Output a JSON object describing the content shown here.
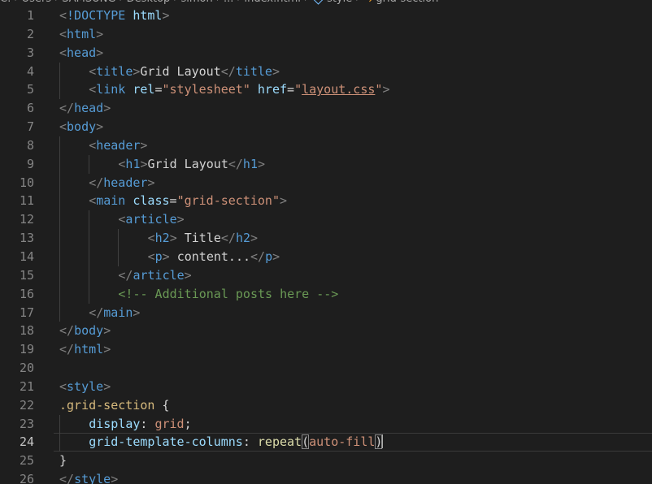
{
  "breadcrumb": {
    "items": [
      "C:",
      "Users",
      "SAMSUNG",
      "Desktop",
      "simon",
      "...",
      "index.html",
      "style",
      "grid-section"
    ],
    "icons": [
      "chevron-right-icon",
      "symbol-namespace-icon",
      "selector-icon"
    ]
  },
  "editor": {
    "current_line": 24,
    "lines": [
      {
        "n": "1",
        "indent": 0,
        "tokens": [
          [
            "punct",
            "<"
          ],
          [
            "tag",
            "!DOCTYPE"
          ],
          [
            "text",
            " "
          ],
          [
            "attr",
            "html"
          ],
          [
            "punct",
            ">"
          ]
        ]
      },
      {
        "n": "2",
        "indent": 0,
        "tokens": [
          [
            "punct",
            "<"
          ],
          [
            "tag",
            "html"
          ],
          [
            "punct",
            ">"
          ]
        ]
      },
      {
        "n": "3",
        "indent": 0,
        "tokens": [
          [
            "punct",
            "<"
          ],
          [
            "tag",
            "head"
          ],
          [
            "punct",
            ">"
          ]
        ]
      },
      {
        "n": "4",
        "indent": 1,
        "tokens": [
          [
            "punct",
            "<"
          ],
          [
            "tag",
            "title"
          ],
          [
            "punct",
            ">"
          ],
          [
            "text",
            "Grid Layout"
          ],
          [
            "punct",
            "</"
          ],
          [
            "tag",
            "title"
          ],
          [
            "punct",
            ">"
          ]
        ]
      },
      {
        "n": "5",
        "indent": 1,
        "tokens": [
          [
            "punct",
            "<"
          ],
          [
            "tag",
            "link"
          ],
          [
            "text",
            " "
          ],
          [
            "attr",
            "rel"
          ],
          [
            "text",
            "="
          ],
          [
            "str",
            "\"stylesheet\""
          ],
          [
            "text",
            " "
          ],
          [
            "attr",
            "href"
          ],
          [
            "text",
            "="
          ],
          [
            "str",
            "\""
          ],
          [
            "strlink",
            "layout.css"
          ],
          [
            "str",
            "\""
          ],
          [
            "punct",
            ">"
          ]
        ]
      },
      {
        "n": "6",
        "indent": 0,
        "tokens": [
          [
            "punct",
            "</"
          ],
          [
            "tag",
            "head"
          ],
          [
            "punct",
            ">"
          ]
        ]
      },
      {
        "n": "7",
        "indent": 0,
        "tokens": [
          [
            "punct",
            "<"
          ],
          [
            "tag",
            "body"
          ],
          [
            "punct",
            ">"
          ]
        ]
      },
      {
        "n": "8",
        "indent": 1,
        "tokens": [
          [
            "punct",
            "<"
          ],
          [
            "tag",
            "header"
          ],
          [
            "punct",
            ">"
          ]
        ]
      },
      {
        "n": "9",
        "indent": 2,
        "tokens": [
          [
            "punct",
            "<"
          ],
          [
            "tag",
            "h1"
          ],
          [
            "punct",
            ">"
          ],
          [
            "text",
            "Grid Layout"
          ],
          [
            "punct",
            "</"
          ],
          [
            "tag",
            "h1"
          ],
          [
            "punct",
            ">"
          ]
        ]
      },
      {
        "n": "10",
        "indent": 1,
        "tokens": [
          [
            "punct",
            "</"
          ],
          [
            "tag",
            "header"
          ],
          [
            "punct",
            ">"
          ]
        ]
      },
      {
        "n": "11",
        "indent": 1,
        "tokens": [
          [
            "punct",
            "<"
          ],
          [
            "tag",
            "main"
          ],
          [
            "text",
            " "
          ],
          [
            "attr",
            "class"
          ],
          [
            "text",
            "="
          ],
          [
            "str",
            "\"grid-section\""
          ],
          [
            "punct",
            ">"
          ]
        ]
      },
      {
        "n": "12",
        "indent": 2,
        "tokens": [
          [
            "punct",
            "<"
          ],
          [
            "tag",
            "article"
          ],
          [
            "punct",
            ">"
          ]
        ]
      },
      {
        "n": "13",
        "indent": 3,
        "tokens": [
          [
            "punct",
            "<"
          ],
          [
            "tag",
            "h2"
          ],
          [
            "punct",
            ">"
          ],
          [
            "text",
            " Title"
          ],
          [
            "punct",
            "</"
          ],
          [
            "tag",
            "h2"
          ],
          [
            "punct",
            ">"
          ]
        ]
      },
      {
        "n": "14",
        "indent": 3,
        "tokens": [
          [
            "punct",
            "<"
          ],
          [
            "tag",
            "p"
          ],
          [
            "punct",
            ">"
          ],
          [
            "text",
            " content..."
          ],
          [
            "punct",
            "</"
          ],
          [
            "tag",
            "p"
          ],
          [
            "punct",
            ">"
          ]
        ]
      },
      {
        "n": "15",
        "indent": 2,
        "tokens": [
          [
            "punct",
            "</"
          ],
          [
            "tag",
            "article"
          ],
          [
            "punct",
            ">"
          ]
        ]
      },
      {
        "n": "16",
        "indent": 2,
        "tokens": [
          [
            "comment",
            "<!-- Additional posts here -->"
          ]
        ]
      },
      {
        "n": "17",
        "indent": 1,
        "tokens": [
          [
            "punct",
            "</"
          ],
          [
            "tag",
            "main"
          ],
          [
            "punct",
            ">"
          ]
        ]
      },
      {
        "n": "18",
        "indent": 0,
        "tokens": [
          [
            "punct",
            "</"
          ],
          [
            "tag",
            "body"
          ],
          [
            "punct",
            ">"
          ]
        ]
      },
      {
        "n": "19",
        "indent": 0,
        "tokens": [
          [
            "punct",
            "</"
          ],
          [
            "tag",
            "html"
          ],
          [
            "punct",
            ">"
          ]
        ]
      },
      {
        "n": "20",
        "indent": 0,
        "tokens": []
      },
      {
        "n": "21",
        "indent": 0,
        "tokens": [
          [
            "punct",
            "<"
          ],
          [
            "tag",
            "style"
          ],
          [
            "punct",
            ">"
          ]
        ]
      },
      {
        "n": "22",
        "indent": 0,
        "tokens": [
          [
            "sel",
            ".grid-section"
          ],
          [
            "plain",
            " {"
          ]
        ]
      },
      {
        "n": "23",
        "indent": 1,
        "tokens": [
          [
            "prop",
            "display"
          ],
          [
            "plain",
            ": "
          ],
          [
            "val",
            "grid"
          ],
          [
            "plain",
            ";"
          ]
        ]
      },
      {
        "n": "24",
        "indent": 1,
        "tokens": [
          [
            "prop",
            "grid-template-columns"
          ],
          [
            "plain",
            ": "
          ],
          [
            "fn",
            "repeat"
          ],
          [
            "bracket",
            "("
          ],
          [
            "val",
            "auto-fill"
          ],
          [
            "bracket",
            ")"
          ],
          [
            "cursor",
            ""
          ]
        ]
      },
      {
        "n": "25",
        "indent": 0,
        "tokens": [
          [
            "plain",
            "}"
          ]
        ]
      },
      {
        "n": "26",
        "indent": 0,
        "tokens": [
          [
            "punct",
            "</"
          ],
          [
            "tag",
            "style"
          ],
          [
            "punct",
            ">"
          ]
        ]
      }
    ]
  }
}
